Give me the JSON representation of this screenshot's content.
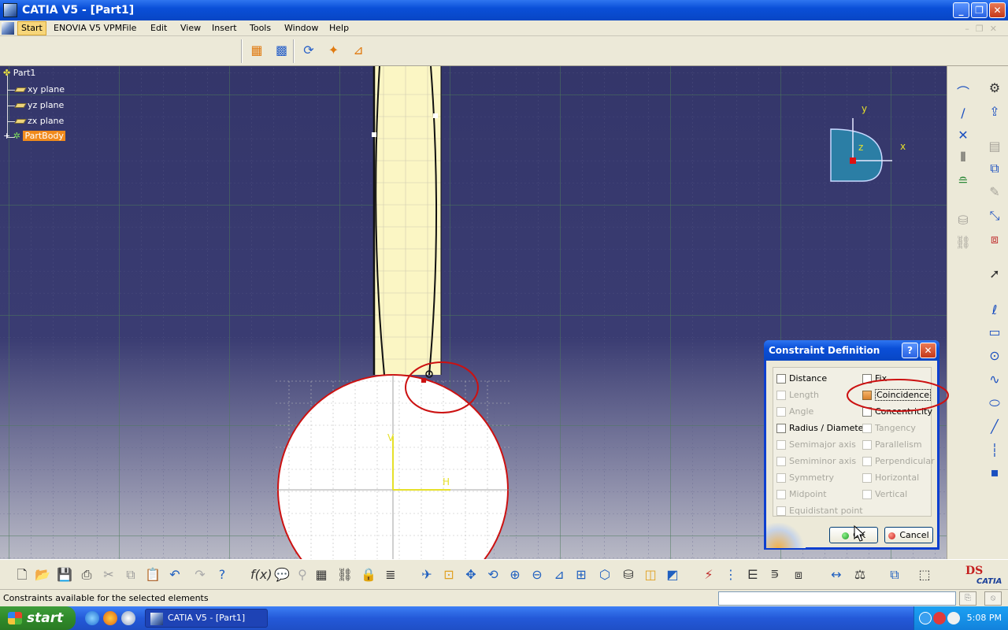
{
  "window": {
    "title": "CATIA V5 - [Part1]"
  },
  "menu": {
    "items": [
      "Start",
      "ENOVIA V5 VPM",
      "File",
      "Edit",
      "View",
      "Insert",
      "Tools",
      "Window",
      "Help"
    ]
  },
  "tree": {
    "root": "Part1",
    "items": [
      "xy plane",
      "yz plane",
      "zx plane",
      "PartBody"
    ]
  },
  "compass": {
    "x_label": "x",
    "y_label": "y",
    "z_label": "z"
  },
  "sketch": {
    "h_label": "H",
    "v_label": "V"
  },
  "dialog": {
    "title": "Constraint Definition",
    "help_label": "?",
    "close_label": "✕",
    "left_options": [
      {
        "label": "Distance",
        "enabled": true,
        "checked": false
      },
      {
        "label": "Length",
        "enabled": false,
        "checked": false
      },
      {
        "label": "Angle",
        "enabled": false,
        "checked": false
      },
      {
        "label": "Radius / Diameter",
        "enabled": true,
        "checked": false
      },
      {
        "label": "Semimajor axis",
        "enabled": false,
        "checked": false
      },
      {
        "label": "Semiminor axis",
        "enabled": false,
        "checked": false
      },
      {
        "label": "Symmetry",
        "enabled": false,
        "checked": false
      },
      {
        "label": "Midpoint",
        "enabled": false,
        "checked": false
      },
      {
        "label": "Equidistant point",
        "enabled": false,
        "checked": false
      }
    ],
    "right_options": [
      {
        "label": "Fix",
        "enabled": true,
        "checked": false
      },
      {
        "label": "Coincidence",
        "enabled": true,
        "checked": true
      },
      {
        "label": "Concentricity",
        "enabled": true,
        "checked": false
      },
      {
        "label": "Tangency",
        "enabled": false,
        "checked": false
      },
      {
        "label": "Parallelism",
        "enabled": false,
        "checked": false
      },
      {
        "label": "Perpendicular",
        "enabled": false,
        "checked": false
      },
      {
        "label": "Horizontal",
        "enabled": false,
        "checked": false
      },
      {
        "label": "Vertical",
        "enabled": false,
        "checked": false
      }
    ],
    "ok_label": "OK",
    "cancel_label": "Cancel"
  },
  "status": {
    "message": "Constraints available for the selected elements",
    "command_value": ""
  },
  "taskbar": {
    "start_label": "start",
    "task_label": "CATIA V5 - [Part1]",
    "clock": "5:08 PM"
  },
  "brand": {
    "logo_text": "CATIA"
  },
  "colors": {
    "selection": "#f08a1c",
    "constraint": "#cc1111",
    "dialog_title": "#0a4fd8"
  }
}
